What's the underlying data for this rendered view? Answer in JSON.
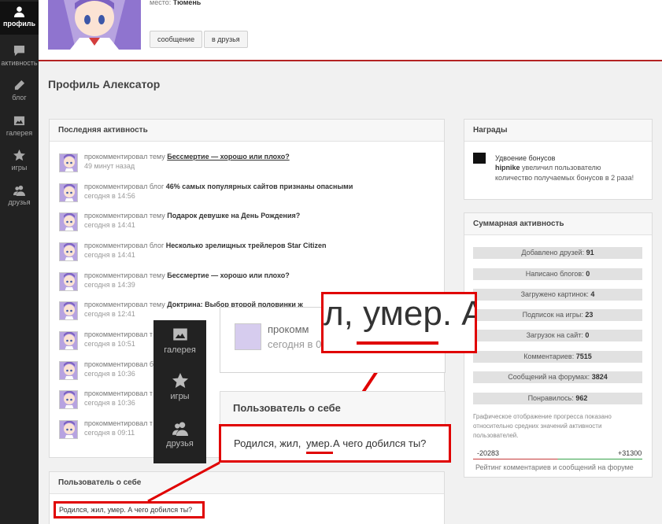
{
  "sidebar": {
    "items": [
      {
        "label": "профиль",
        "icon": "user-icon"
      },
      {
        "label": "активность",
        "icon": "chat-icon"
      },
      {
        "label": "блог",
        "icon": "pencil-icon"
      },
      {
        "label": "галерея",
        "icon": "image-icon"
      },
      {
        "label": "игры",
        "icon": "star-icon"
      },
      {
        "label": "друзья",
        "icon": "friends-icon"
      }
    ]
  },
  "header": {
    "city_label": "место:",
    "city_value": "Тюмень",
    "message_button": "сообщение",
    "friend_button": "в друзья"
  },
  "page_title": "Профиль Алексатор",
  "activity": {
    "title": "Последняя активность",
    "items": [
      {
        "action": "прокомментировал тему",
        "subject": "Бессмертие — хорошо или плохо?",
        "time": "49 минут назад"
      },
      {
        "action": "прокомментировал блог",
        "subject": "46% самых популярных сайтов признаны опасными",
        "time": "сегодня в 14:56"
      },
      {
        "action": "прокомментировал тему",
        "subject": "Подарок девушке на День Рождения?",
        "time": "сегодня в 14:41"
      },
      {
        "action": "прокомментировал блог",
        "subject": "Несколько зрелищных трейлеров Star Citizen",
        "time": "сегодня в 14:41"
      },
      {
        "action": "прокомментировал тему",
        "subject": "Бессмертие — хорошо или плохо?",
        "time": "сегодня в 14:39"
      },
      {
        "action": "прокомментировал тему",
        "subject": "Доктрина: Выбор второй половинки ж",
        "time": "сегодня в 12:41"
      },
      {
        "action": "прокомментировал т",
        "subject": "",
        "time": "сегодня в 10:51"
      },
      {
        "action": "прокомментировал б",
        "subject": "",
        "time": "сегодня в 10:36"
      },
      {
        "action": "прокомментировал т",
        "subject": "",
        "time": "сегодня в 10:36"
      },
      {
        "action": "прокомментировал т",
        "subject": "",
        "time": "сегодня в 09:11"
      }
    ]
  },
  "about": {
    "title": "Пользователь о себе",
    "text": "Родился, жил, умер. А чего добился ты?"
  },
  "awards": {
    "title": "Награды",
    "name": "Удвоение бонусов",
    "user": "hipnike",
    "desc": "увеличил пользователю",
    "desc2": "количество получаемых бонусов в 2 раза!"
  },
  "summary": {
    "title": "Суммарная активность",
    "rows": [
      {
        "label": "Добавлено друзей:",
        "value": "91"
      },
      {
        "label": "Написано блогов:",
        "value": "0"
      },
      {
        "label": "Загружено картинок:",
        "value": "4"
      },
      {
        "label": "Подписок на игры:",
        "value": "23"
      },
      {
        "label": "Загрузок на сайт:",
        "value": "0"
      },
      {
        "label": "Комментариев:",
        "value": "7515"
      },
      {
        "label": "Сообщений на форумах:",
        "value": "3824"
      },
      {
        "label": "Понравилось:",
        "value": "962"
      }
    ],
    "note": "Графическое отображение прогресса показано относительно средних значений активности пользователей.",
    "scale_min": "-20283",
    "scale_max": "+31300",
    "scale_caption": "Рейтинг комментариев и сообщений на форуме"
  },
  "zoom": {
    "sidebar": [
      {
        "label": "галерея",
        "icon": "image-icon"
      },
      {
        "label": "игры",
        "icon": "star-icon"
      },
      {
        "label": "друзья",
        "icon": "friends-icon"
      }
    ],
    "act_line": "прокомм",
    "act_time": "сегодня в 0",
    "about_title": "Пользователь о себе",
    "text_before": "Родился, жил,",
    "word": "умер.",
    "text_after": "А чего добился ты?",
    "big_text": "л, умер. А"
  },
  "colors": {
    "accent_red": "#e00000",
    "header_line": "#b42323",
    "sidebar_bg": "#222222"
  }
}
